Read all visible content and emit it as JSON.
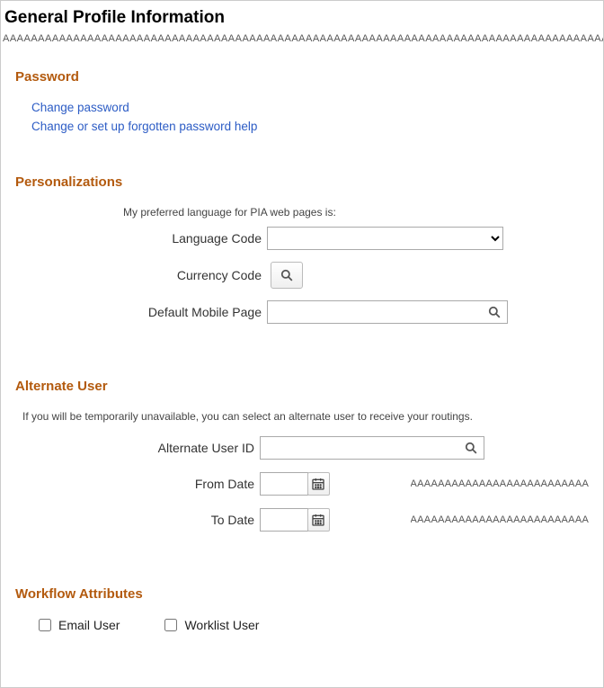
{
  "page": {
    "title": "General Profile Information",
    "underline_pattern": "AAAAAAAAAAAAAAAAAAAAAAAAAAAAAAAAAAAAAAAAAAAAAAAAAAAAAAAAAAAAAAAAAAAAAAAAAAAAAAAAAAAAAAAAAAAAAAAAAAAAAAAAAAAAAAAAAAAAAAAAAAAAAAAAAAAAAAAAAA"
  },
  "password": {
    "heading": "Password",
    "change_password_link": "Change password",
    "forgotten_password_link": "Change or set up forgotten password help"
  },
  "personalizations": {
    "heading": "Personalizations",
    "help_text": "My preferred language for PIA web pages is:",
    "language_code_label": "Language Code",
    "language_code_value": "",
    "currency_code_label": "Currency Code",
    "default_mobile_page_label": "Default Mobile Page",
    "default_mobile_page_value": ""
  },
  "alternate_user": {
    "heading": "Alternate User",
    "help_text": "If you will be temporarily unavailable, you can select an alternate user to receive your routings.",
    "alternate_user_id_label": "Alternate User ID",
    "alternate_user_id_value": "",
    "from_date_label": "From Date",
    "from_date_value": "",
    "to_date_label": "To Date",
    "to_date_value": "",
    "date_example_text": "AAAAAAAAAAAAAAAAAAAAAAAAAAAAAA"
  },
  "workflow": {
    "heading": "Workflow Attributes",
    "email_user_label": "Email User",
    "worklist_user_label": "Worklist User"
  }
}
